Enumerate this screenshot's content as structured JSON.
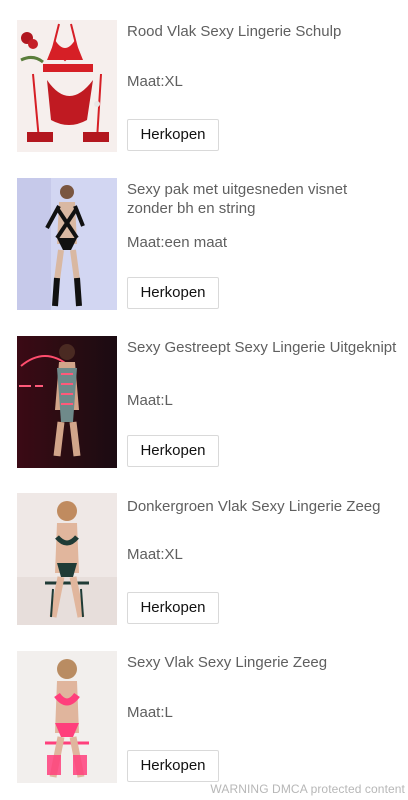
{
  "products": [
    {
      "title": "Rood Vlak Sexy Lingerie Schulp",
      "size": "Maat:XL",
      "button": "Herkopen",
      "image": "lingerie-photo",
      "color": "#d61f26"
    },
    {
      "title": "Sexy pak met uitgesneden visnet zonder bh en string",
      "size": "Maat:een maat",
      "button": "Herkopen",
      "image": "model-photo",
      "color": "#1d1d24"
    },
    {
      "title": "Sexy Gestreept Sexy Lingerie Uitgeknipt",
      "size": "Maat:L",
      "button": "Herkopen",
      "image": "model-photo",
      "color": "#7a8e8a"
    },
    {
      "title": "Donkergroen Vlak Sexy Lingerie Zeeg",
      "size": "Maat:XL",
      "button": "Herkopen",
      "image": "model-photo",
      "color": "#1f3b36"
    },
    {
      "title": "Sexy Vlak Sexy Lingerie Zeeg",
      "size": "Maat:L",
      "button": "Herkopen",
      "image": "model-photo",
      "color": "#ff3f7c"
    }
  ],
  "watermark": "WARNING DMCA protected content"
}
